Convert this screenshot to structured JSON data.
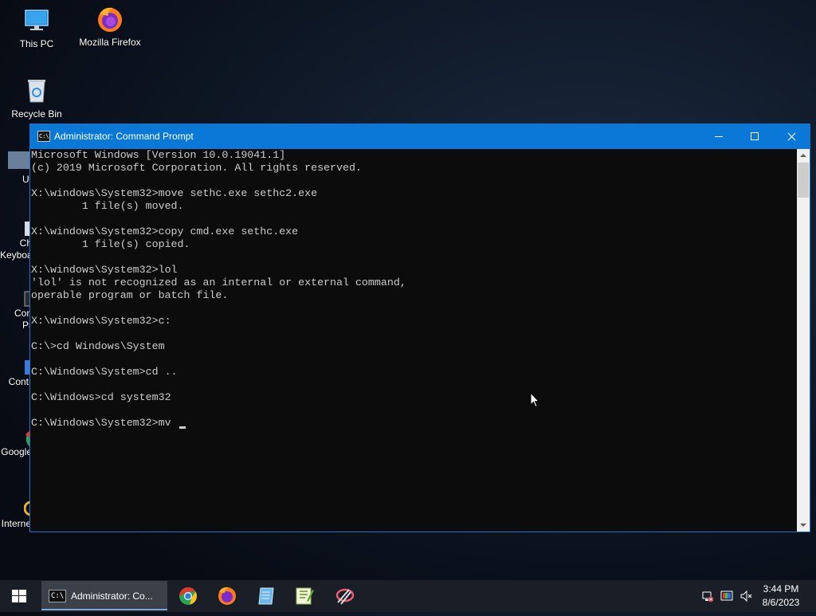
{
  "desktop": {
    "icons": [
      {
        "label": "This PC"
      },
      {
        "label": "Mozilla Firefox"
      },
      {
        "label": "Recycle Bin"
      },
      {
        "label": "Ut"
      },
      {
        "label": "Ch"
      },
      {
        "label": "Keyboa"
      },
      {
        "label": "Con"
      },
      {
        "label": "Pr"
      },
      {
        "label": "Contr"
      },
      {
        "label": "Google"
      },
      {
        "label": "Internet Explorer"
      }
    ]
  },
  "window": {
    "title": "Administrator: Command Prompt",
    "icon_text": "C:\\",
    "console_lines": [
      "Microsoft Windows [Version 10.0.19041.1]",
      "(c) 2019 Microsoft Corporation. All rights reserved.",
      "",
      "X:\\windows\\System32>move sethc.exe sethc2.exe",
      "        1 file(s) moved.",
      "",
      "X:\\windows\\System32>copy cmd.exe sethc.exe",
      "        1 file(s) copied.",
      "",
      "X:\\windows\\System32>lol",
      "'lol' is not recognized as an internal or external command,",
      "operable program or batch file.",
      "",
      "X:\\windows\\System32>c:",
      "",
      "C:\\>cd Windows\\System",
      "",
      "C:\\Windows\\System>cd ..",
      "",
      "C:\\Windows>cd system32",
      "",
      "C:\\Windows\\System32>mv "
    ]
  },
  "taskbar": {
    "active_task_label": "Administrator: Co...",
    "active_task_icon_text": "C:\\",
    "pinned": [
      "chrome-icon",
      "firefox-icon",
      "notepad-icon",
      "notepad-plus-icon",
      "snipping-tool-icon"
    ],
    "tray": [
      "network-disconnected-icon",
      "display-color-icon",
      "volume-muted-icon"
    ],
    "clock": {
      "time": "3:44 PM",
      "date": "8/6/2023"
    }
  },
  "colors": {
    "titlebar": "#0a78d7",
    "console_bg": "#0c0c0c",
    "console_fg": "#cccccc",
    "taskbar": "#1a1f27"
  }
}
